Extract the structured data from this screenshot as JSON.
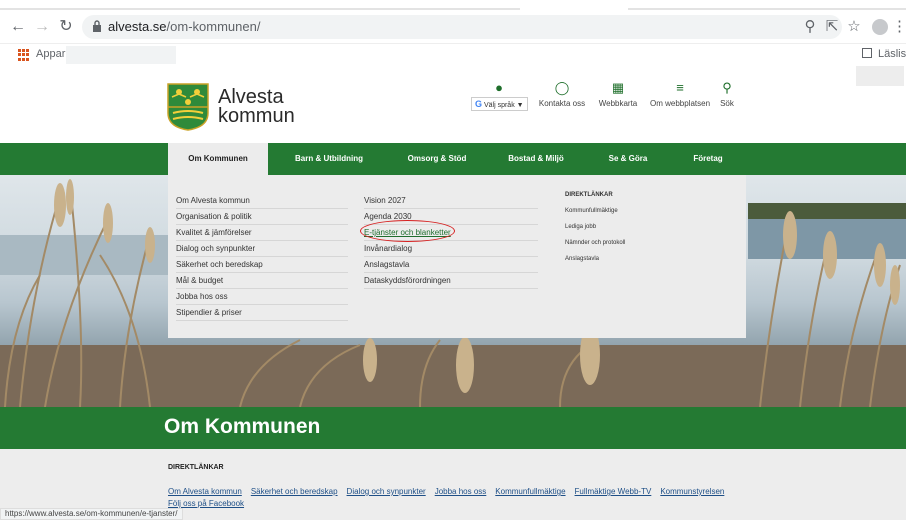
{
  "browser": {
    "url_host": "alvesta.se",
    "url_path": "/om-kommunen/",
    "bookmarks_apps_label": "Appar",
    "reading_list_label": "Läslista",
    "status_url": "https://www.alvesta.se/om-kommunen/e-tjanster/"
  },
  "header": {
    "brand_line1": "Alvesta",
    "brand_line2": "kommun",
    "language_select": "Välj språk",
    "utilities": [
      {
        "icon": "chat-bubble-icon",
        "label": "Kontakta oss"
      },
      {
        "icon": "sitemap-icon",
        "label": "Webbkarta"
      },
      {
        "icon": "menu-icon",
        "label": "Om webbplatsen"
      },
      {
        "icon": "search-icon",
        "label": "Sök"
      }
    ]
  },
  "nav": {
    "items": [
      "Om Kommunen",
      "Barn & Utbildning",
      "Omsorg & Stöd",
      "Bostad & Miljö",
      "Se & Göra",
      "Företag"
    ],
    "active": "Om Kommunen"
  },
  "megamenu": {
    "col1": [
      "Om Alvesta kommun",
      "Organisation & politik",
      "Kvalitet & jämförelser",
      "Dialog och synpunkter",
      "Säkerhet och beredskap",
      "Mål & budget",
      "Jobba hos oss",
      "Stipendier & priser"
    ],
    "col2": [
      "Vision 2027",
      "Agenda 2030",
      "E-tjänster och blanketter",
      "Invånardialog",
      "Anslagstavla",
      "Dataskyddsförordningen"
    ],
    "quick_heading": "DIREKTLÄNKAR",
    "quick_links": [
      "Kommunfullmäktige",
      "Lediga jobb",
      "Nämnder och protokoll",
      "Anslagstavla"
    ]
  },
  "page": {
    "title": "Om Kommunen",
    "direct_heading": "DIREKTLÄNKAR",
    "direct_links": [
      "Om Alvesta kommun",
      "Säkerhet och beredskap",
      "Dialog och synpunkter",
      "Jobba hos oss",
      "Kommunfullmäktige",
      "Fullmäktige Webb-TV",
      "Kommunstyrelsen"
    ],
    "facebook_link": "Följ oss på Facebook"
  },
  "colors": {
    "brand_green": "#247a33",
    "highlight_circle": "#d62020"
  }
}
